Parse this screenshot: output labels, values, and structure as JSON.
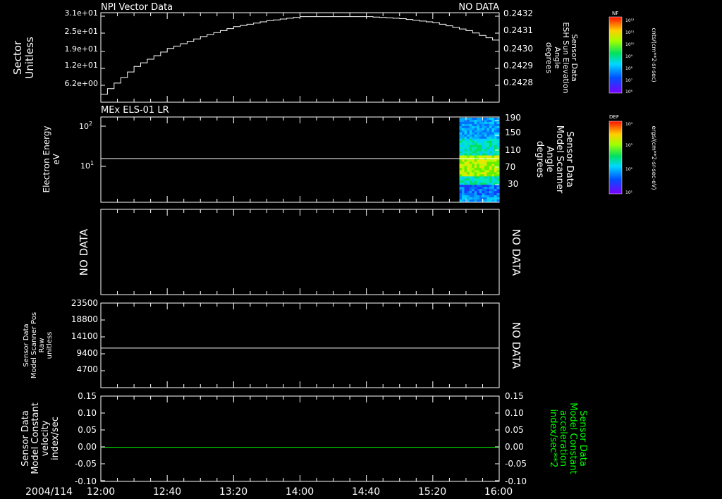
{
  "date_label": "2004/114",
  "x_ticks": [
    "12:00",
    "12:40",
    "13:20",
    "14:00",
    "14:40",
    "15:20",
    "16:00"
  ],
  "colors": {
    "background": "#000000",
    "axis": "#ffffff",
    "green_trace": "#00ff00"
  },
  "panels": {
    "p1": {
      "title": "NPI Vector Data",
      "status": "NO DATA",
      "ylabel": [
        "Sector",
        "Unitless"
      ],
      "left_ticks": [
        "3.1e+01",
        "2.5e+01",
        "1.9e+01",
        "1.2e+01",
        "6.2e+00"
      ],
      "right_ticks": [
        "0.2432",
        "0.2431",
        "0.2430",
        "0.2429",
        "0.2428"
      ],
      "right_label": [
        "Sensor Data",
        "ESH Sun Elevation",
        "Angle",
        "degrees"
      ]
    },
    "p2": {
      "title": "MEx ELS-01 LR",
      "ylabel": [
        "Electron Energy",
        "eV"
      ],
      "right_ticks": [
        "190",
        "150",
        "110",
        "70",
        "30"
      ],
      "right_label": [
        "Sensor Data",
        "Model Scanner",
        "Angle",
        "degrees"
      ]
    },
    "p3": {
      "left_status": "NO DATA",
      "right_status": "NO DATA"
    },
    "p4": {
      "left_ticks": [
        "23500",
        "18800",
        "14100",
        "9400",
        "4700"
      ],
      "ylabel": [
        "Sensor Data",
        "Model Scanner Pos",
        "Raw",
        "unitless"
      ],
      "right_status": "NO DATA"
    },
    "p5": {
      "left_ticks": [
        "0.15",
        "0.10",
        "0.05",
        "0.00",
        "-0.05",
        "-0.10"
      ],
      "right_ticks": [
        "0.15",
        "0.10",
        "0.05",
        "0.00",
        "-0.05",
        "-0.10"
      ],
      "ylabel": [
        "Sensor Data",
        "Model Constant",
        "velocity",
        "index/sec"
      ],
      "right_label": [
        "Sensor Data",
        "Model Constant",
        "acceleration",
        "index/sec**2"
      ]
    }
  },
  "colorbars": {
    "cb1": {
      "title": "NF",
      "label": "cnts/(cm**2-sr-sec)",
      "ticks": [
        "10¹²",
        "10¹¹",
        "10¹⁰",
        "10⁹",
        "10⁸",
        "10⁷",
        "10⁶"
      ]
    },
    "cb2": {
      "title": "DEF",
      "label": "ergs/(cm**2-sr-sec-eV)",
      "ticks": [
        "10⁴",
        "10³",
        "10²",
        "10¹"
      ]
    }
  },
  "chart_data": [
    {
      "type": "line",
      "title": "NPI Vector Data",
      "ylabel": "Sector Unitless",
      "x": [
        "12:00",
        "12:20",
        "12:40",
        "13:00",
        "13:20",
        "13:40",
        "14:00",
        "14:20",
        "14:40",
        "15:00",
        "15:20",
        "15:40",
        "16:00"
      ],
      "values": [
        0.24279,
        0.24293,
        0.24302,
        0.24308,
        0.24313,
        0.24316,
        0.24318,
        0.24318,
        0.24318,
        0.24317,
        0.24315,
        0.24311,
        0.24305
      ],
      "ylim": [
        0.24275,
        0.2432
      ]
    },
    {
      "type": "heatmap",
      "title": "MEx ELS-01 LR",
      "ylabel": "Sensor Data Model Scanner Angle degrees",
      "data_start": "15:36",
      "data_end": "16:00",
      "ylim": [
        0,
        190
      ],
      "line_value_eV": 15
    },
    {
      "type": "line",
      "ylabel": "Sensor Data Model Scanner Pos Raw unitless",
      "values": [
        11000,
        11000
      ],
      "ylim": [
        0,
        23500
      ]
    },
    {
      "type": "line",
      "ylabel": "Sensor Data Model Constant velocity index/sec",
      "values": [
        0.0,
        0.0
      ],
      "ylim": [
        -0.1,
        0.15
      ]
    }
  ]
}
